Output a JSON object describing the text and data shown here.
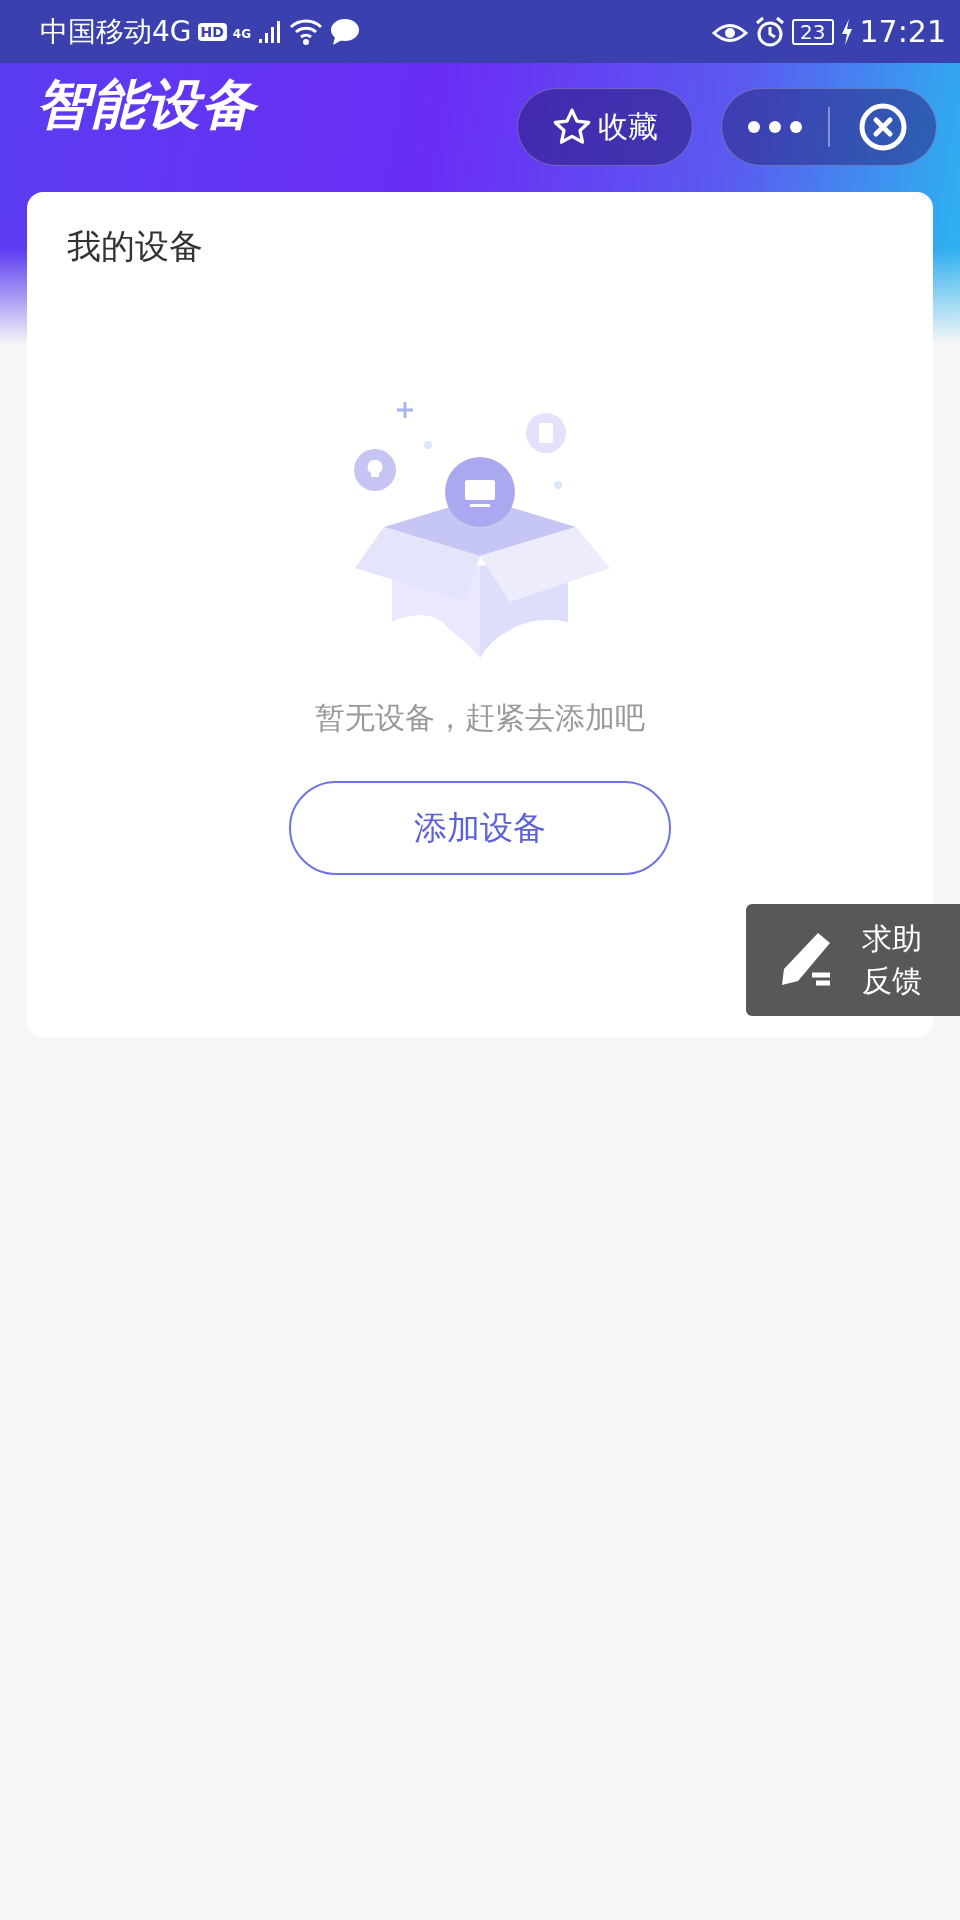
{
  "status_bar": {
    "carrier": "中国移动4G",
    "hd_badge": "HD",
    "network": "4G",
    "battery": "23",
    "time": "17:21"
  },
  "header": {
    "title": "智能设备",
    "favorite_button": "收藏"
  },
  "card": {
    "title": "我的设备",
    "empty_message": "暂无设备，赶紧去添加吧",
    "add_button": "添加设备"
  },
  "feedback_button": {
    "lines": [
      "求助",
      "反馈"
    ]
  }
}
